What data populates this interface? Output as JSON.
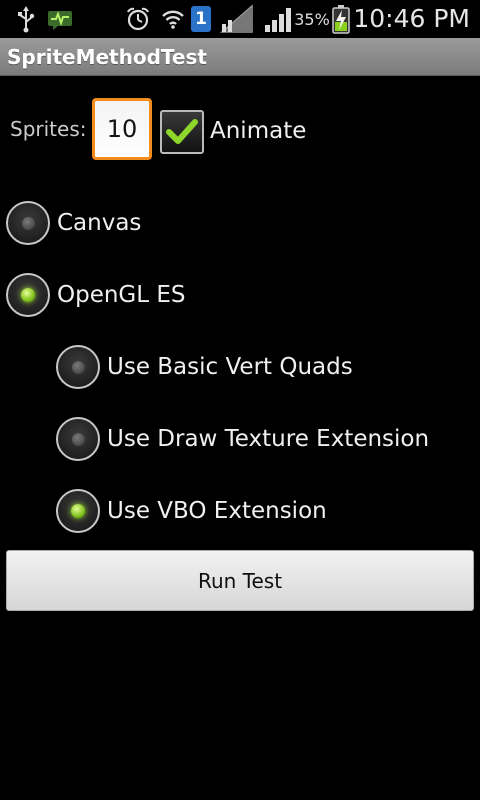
{
  "status_bar": {
    "icons": [
      "usb-icon",
      "pulse-app-icon",
      "alarm-icon",
      "wifi-icon",
      "sim-icon",
      "signal-icon",
      "signal-icon",
      "battery-charging-icon"
    ],
    "sim_number": "1",
    "battery_percent": "35%",
    "time": "10:46 PM"
  },
  "title_bar": {
    "title": "SpriteMethodTest"
  },
  "sprites": {
    "label": "Sprites:",
    "value": "10"
  },
  "animate": {
    "label": "Animate",
    "checked": true
  },
  "renderer_options": [
    {
      "label": "Canvas",
      "checked": false
    },
    {
      "label": "OpenGL ES",
      "checked": true
    }
  ],
  "gl_options": [
    {
      "label": "Use Basic Vert Quads",
      "checked": false
    },
    {
      "label": "Use Draw Texture Extension",
      "checked": false
    },
    {
      "label": "Use VBO Extension",
      "checked": true
    }
  ],
  "run_button": {
    "label": "Run Test"
  },
  "colors": {
    "accent_orange": "#f28c1c",
    "check_green": "#7fc11a",
    "title_gray": "#8c8c8c"
  }
}
